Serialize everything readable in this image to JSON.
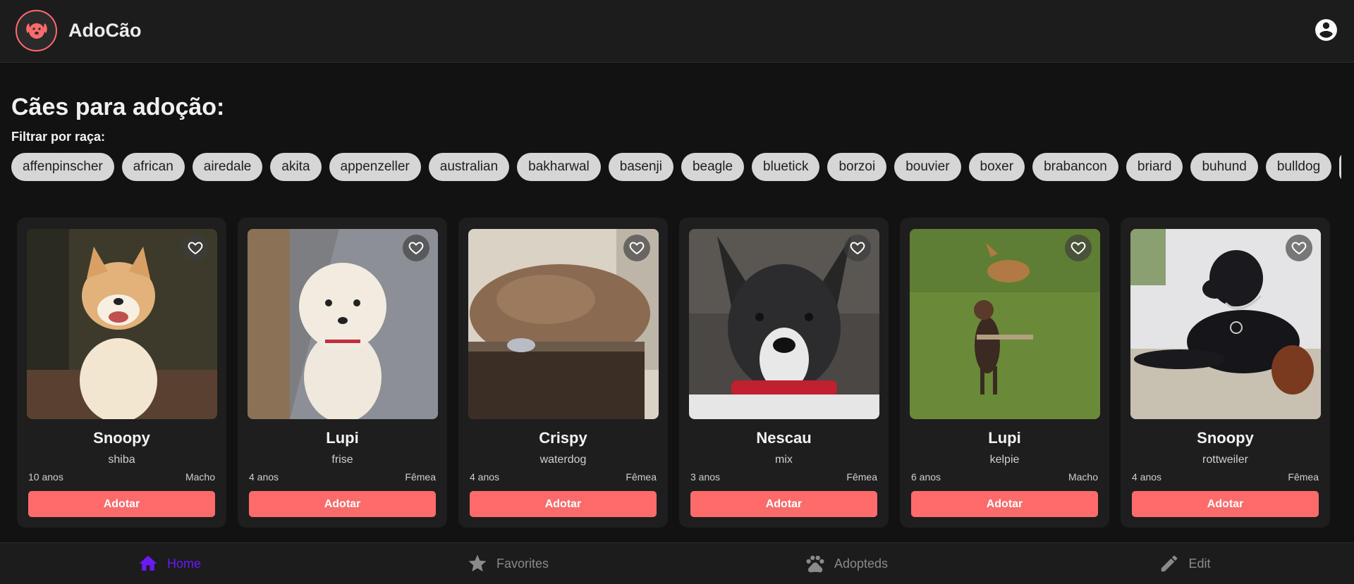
{
  "app": {
    "title": "AdoCão"
  },
  "page": {
    "heading": "Cães para adoção:",
    "filter_label": "Filtrar por raça:"
  },
  "breeds": [
    "affenpinscher",
    "african",
    "airedale",
    "akita",
    "appenzeller",
    "australian",
    "bakharwal",
    "basenji",
    "beagle",
    "bluetick",
    "borzoi",
    "bouvier",
    "boxer",
    "brabancon",
    "briard",
    "buhund",
    "bulldog"
  ],
  "dogs": [
    {
      "name": "Snoopy",
      "breed": "shiba",
      "age": "10 anos",
      "sex": "Macho",
      "button": "Adotar"
    },
    {
      "name": "Lupi",
      "breed": "frise",
      "age": "4 anos",
      "sex": "Fêmea",
      "button": "Adotar"
    },
    {
      "name": "Crispy",
      "breed": "waterdog",
      "age": "4 anos",
      "sex": "Fêmea",
      "button": "Adotar"
    },
    {
      "name": "Nescau",
      "breed": "mix",
      "age": "3 anos",
      "sex": "Fêmea",
      "button": "Adotar"
    },
    {
      "name": "Lupi",
      "breed": "kelpie",
      "age": "6 anos",
      "sex": "Macho",
      "button": "Adotar"
    },
    {
      "name": "Snoopy",
      "breed": "rottweiler",
      "age": "4 anos",
      "sex": "Fêmea",
      "button": "Adotar"
    }
  ],
  "nav": {
    "items": [
      {
        "label": "Home",
        "icon": "home-icon",
        "active": true
      },
      {
        "label": "Favorites",
        "icon": "star-icon",
        "active": false
      },
      {
        "label": "Adopteds",
        "icon": "paw-icon",
        "active": false
      },
      {
        "label": "Edit",
        "icon": "pencil-icon",
        "active": false
      }
    ]
  },
  "colors": {
    "accent": "#ff6b6b",
    "nav_active": "#6b19f7",
    "background": "#121212",
    "card": "#1e1e1e",
    "chip": "#d6d6d6"
  }
}
